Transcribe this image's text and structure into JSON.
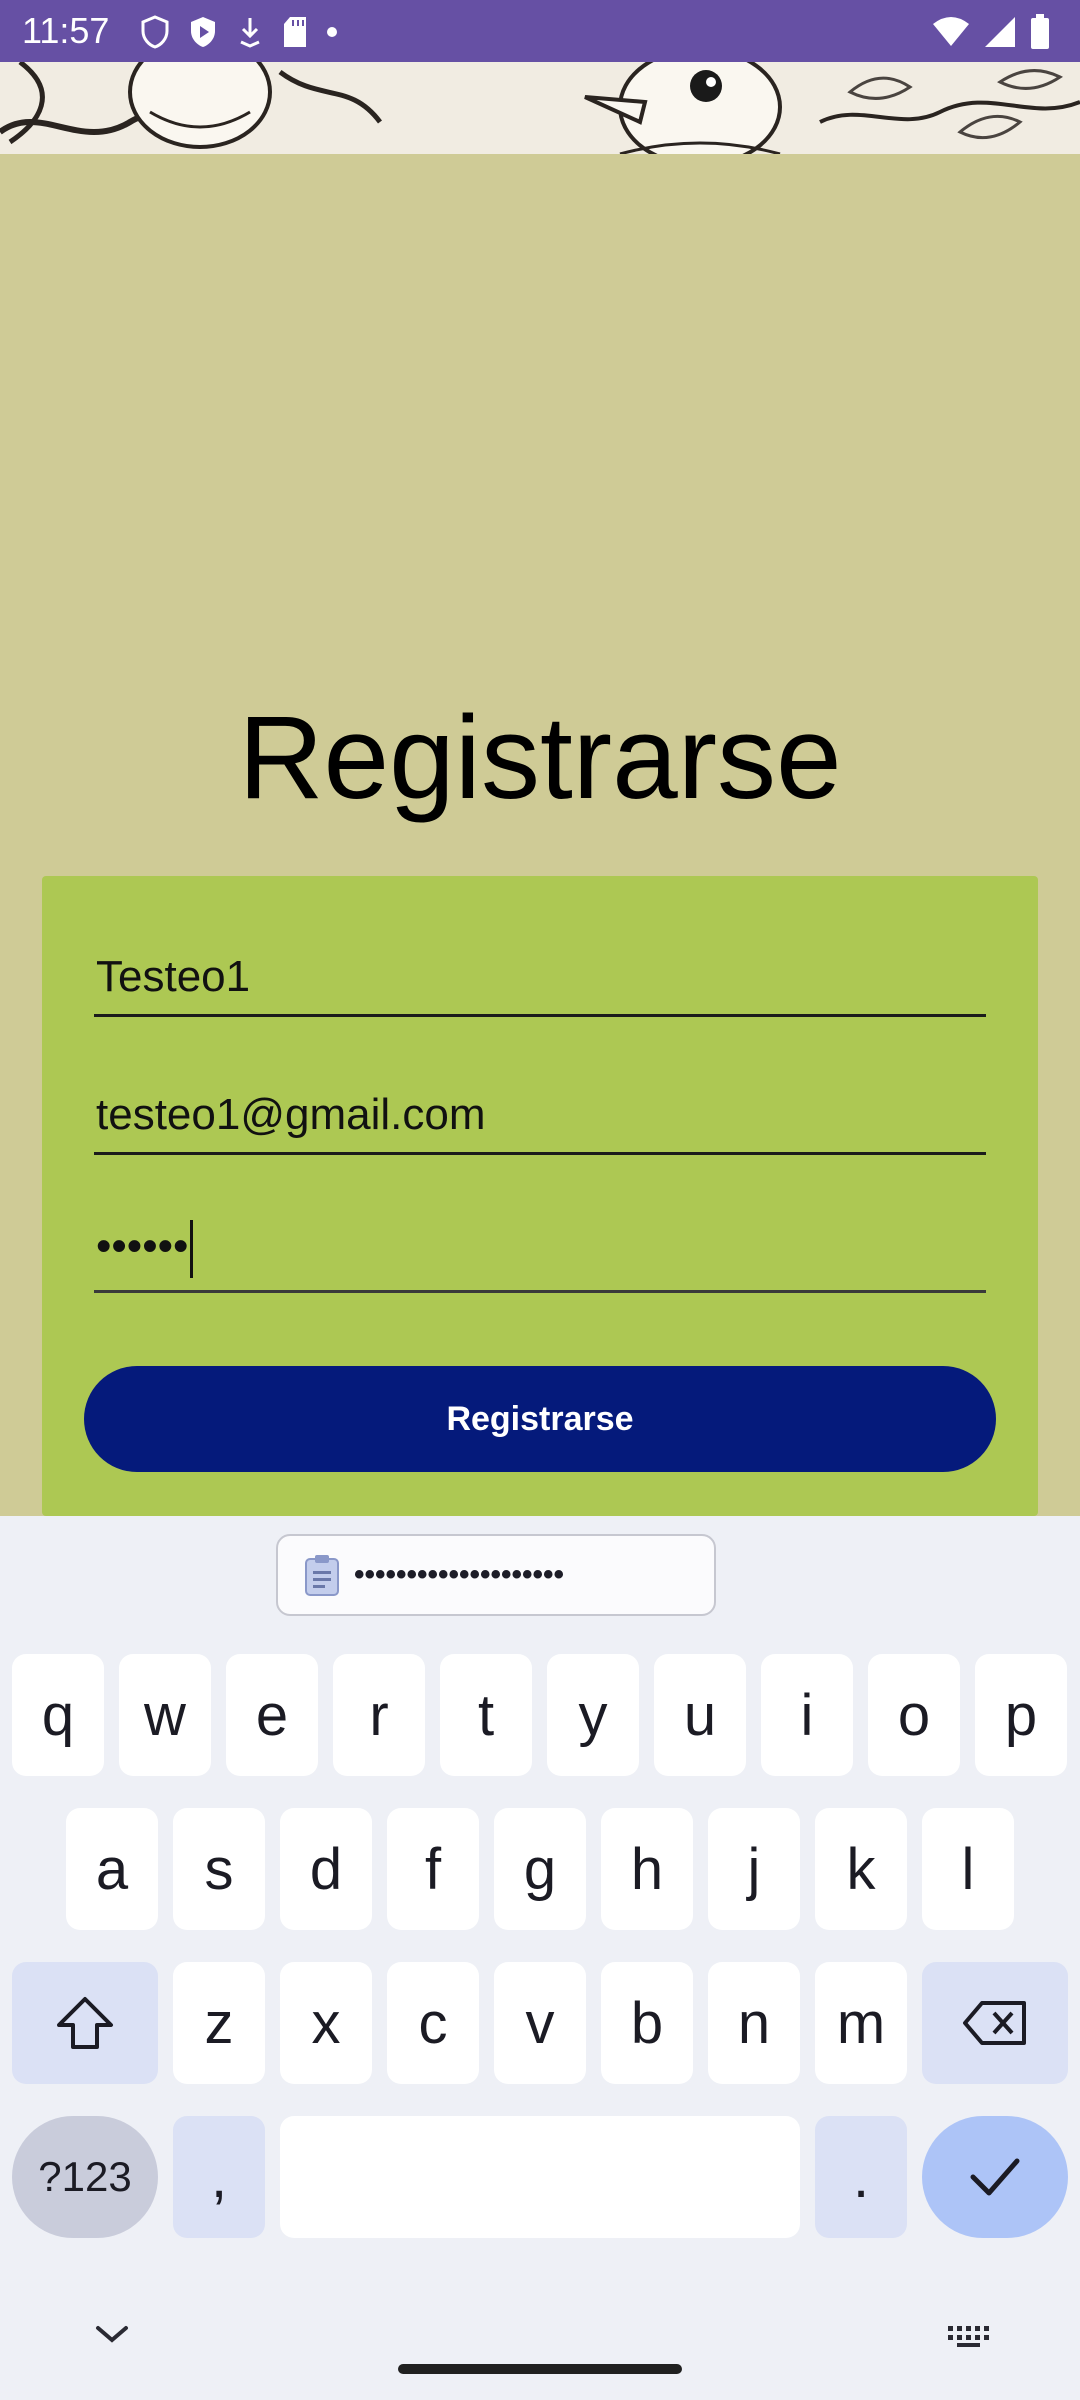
{
  "status_bar": {
    "time": "11:57"
  },
  "page": {
    "title": "Registrarse"
  },
  "form": {
    "username_value": "Testeo1",
    "email_value": "testeo1@gmail.com",
    "password_masked": "••••••",
    "submit_label": "Registrarse"
  },
  "keyboard": {
    "clipboard_suggestion": "••••••••••••••••••••",
    "row1": [
      "q",
      "w",
      "e",
      "r",
      "t",
      "y",
      "u",
      "i",
      "o",
      "p"
    ],
    "row2": [
      "a",
      "s",
      "d",
      "f",
      "g",
      "h",
      "j",
      "k",
      "l"
    ],
    "row3": [
      "z",
      "x",
      "c",
      "v",
      "b",
      "n",
      "m"
    ],
    "symbols_label": "?123",
    "comma_label": ",",
    "period_label": "."
  },
  "colors": {
    "status_bar": "#6650a4",
    "background": "#cfcb96",
    "card": "#adc853",
    "button": "#051a7b"
  },
  "icons": [
    "shield-icon",
    "play-store-icon",
    "download-icon",
    "sd-card-icon",
    "wifi-icon",
    "signal-icon",
    "battery-icon",
    "clipboard-icon",
    "shift-icon",
    "backspace-icon",
    "check-icon",
    "chevron-down-icon",
    "keyboard-grid-icon"
  ]
}
